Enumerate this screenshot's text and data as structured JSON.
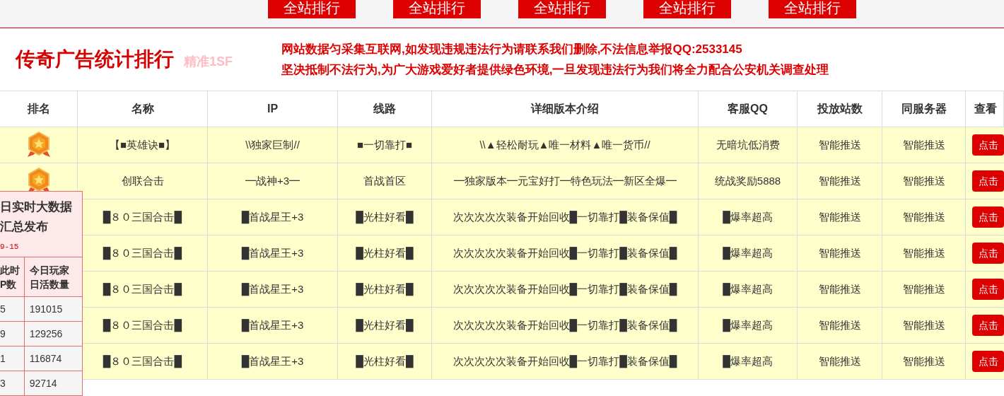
{
  "top_nav": {
    "buttons": [
      "全站排行",
      "全站排行",
      "全站排行",
      "全站排行",
      "全站排行"
    ]
  },
  "header": {
    "title": "传奇广告统计排行",
    "subtitle": "精准1SF",
    "notices": [
      "网站数据匀采集互联网,如发现违规违法行为请联系我们删除,不法信息举报QQ:2533145",
      "坚决抵制不法行为,为广大游戏爱好者提供绿色环境,一旦发现违法行为我们将全力配合公安机关调查处理"
    ]
  },
  "table": {
    "columns": [
      "排名",
      "名称",
      "IP",
      "线路",
      "详细版本介绍",
      "客服QQ",
      "投放站数",
      "同服务器",
      "查看"
    ],
    "rows": [
      {
        "medal": true,
        "cells": [
          "",
          "【■英雄诀■】",
          "\\\\独家巨制//",
          "■一切靠打■",
          "\\\\▲轻松耐玩▲唯一材料▲唯一货币//",
          "无暗坑低消费",
          "智能推送",
          "智能推送"
        ],
        "button": "点击"
      },
      {
        "medal": true,
        "cells": [
          "",
          "创联合击",
          "━战神+3━",
          "首战首区",
          "━独家版本━元宝好打━特色玩法━新区全爆━",
          "统战奖励5888",
          "智能推送",
          "智能推送"
        ],
        "button": "点击"
      },
      {
        "cells": [
          "",
          "█８０三国合击█",
          "█首战星王+3",
          "█光柱好看█",
          "次次次次次装备开始回收█一切靠打█装备保值█",
          "█爆率超高",
          "智能推送",
          "智能推送"
        ],
        "button": "点击"
      },
      {
        "cells": [
          "",
          "█８０三国合击█",
          "█首战星王+3",
          "█光柱好看█",
          "次次次次次装备开始回收█一切靠打█装备保值█",
          "█爆率超高",
          "智能推送",
          "智能推送"
        ],
        "button": "点击"
      },
      {
        "cells": [
          "",
          "█８０三国合击█",
          "█首战星王+3",
          "█光柱好看█",
          "次次次次次装备开始回收█一切靠打█装备保值█",
          "█爆率超高",
          "智能推送",
          "智能推送"
        ],
        "button": "点击"
      },
      {
        "cells": [
          "",
          "█８０三国合击█",
          "█首战星王+3",
          "█光柱好看█",
          "次次次次次装备开始回收█一切靠打█装备保值█",
          "█爆率超高",
          "智能推送",
          "智能推送"
        ],
        "button": "点击"
      },
      {
        "cells": [
          "",
          "█８０三国合击█",
          "█首战星王+3",
          "█光柱好看█",
          "次次次次次装备开始回收█一切靠打█装备保值█",
          "█爆率超高",
          "智能推送",
          "智能推送"
        ],
        "button": "点击"
      }
    ]
  },
  "stats_panel": {
    "title": [
      "日实时大数据",
      "汇总发布"
    ],
    "date": "9-15",
    "columns": [
      "此时P数",
      "今日玩家日活数量"
    ],
    "rows": [
      [
        "5",
        "191015"
      ],
      [
        "9",
        "129256"
      ],
      [
        "1",
        "116874"
      ],
      [
        "3",
        "92714"
      ]
    ]
  }
}
